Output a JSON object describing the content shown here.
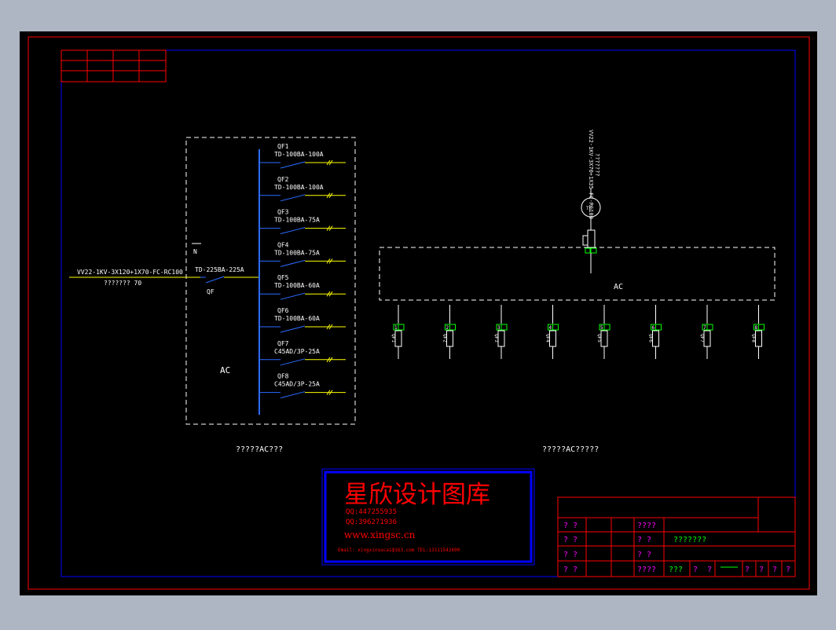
{
  "colors": {
    "viewport_bg": "#aeb6c3",
    "drawing_bg": "#000000",
    "outer_frame": "#ff0000",
    "inner_frame": "#0000ff",
    "line_white": "#ffffff",
    "bus_blue": "#0000ff",
    "breaker_blue": "#2b6cff",
    "feeder_yellow": "#ffff00",
    "green": "#00ff00",
    "magenta": "#ff00ff",
    "stamp_red": "#ff0000"
  },
  "left_diagram": {
    "incoming_cable": "VV22-1KV-3X120+1X70-FC-RC100",
    "incoming_sub": "???????  70",
    "neutral_label": "N",
    "main_breaker_spec": "TD-225BA-225A",
    "main_breaker_label": "QF",
    "panel_label": "AC",
    "caption": "?????AC???",
    "breakers": [
      {
        "name": "QF1",
        "spec": "TD-100BA-100A"
      },
      {
        "name": "QF2",
        "spec": "TD-100BA-100A"
      },
      {
        "name": "QF3",
        "spec": "TD-100BA-75A"
      },
      {
        "name": "QF4",
        "spec": "TD-100BA-75A"
      },
      {
        "name": "QF5",
        "spec": "TD-100BA-60A"
      },
      {
        "name": "QF6",
        "spec": "TD-100BA-60A"
      },
      {
        "name": "QF7",
        "spec": "C45AD/3P-25A"
      },
      {
        "name": "QF8",
        "spec": "C45AD/3P-25A"
      }
    ]
  },
  "right_diagram": {
    "cable_label": "VV22-1KV-3X70+1X35-FC-RC100",
    "cable_sub": "???????",
    "meter_label": "TB",
    "panel_label": "AC",
    "caption": "?????AC?????",
    "feeders": [
      {
        "id": "1",
        "name": "QF1"
      },
      {
        "id": "2",
        "name": "QF2"
      },
      {
        "id": "3",
        "name": "QF3"
      },
      {
        "id": "4",
        "name": "QF4"
      },
      {
        "id": "5",
        "name": "QF5"
      },
      {
        "id": "6",
        "name": "QF6"
      },
      {
        "id": "7",
        "name": "QF7"
      },
      {
        "id": "8",
        "name": "QF8"
      }
    ]
  },
  "stamp": {
    "title": "星欣设计图库",
    "qq1": "QQ:447255935",
    "qq2": "QQ:396271936",
    "website": "www.xingsc.cn",
    "email_line": "Email: xingxinsucai@163.com  TEL:13111542600"
  },
  "title_block": {
    "r1c1": "? ?",
    "r1c3": "????",
    "r2c1": "? ?",
    "r2c3": "?  ?",
    "r2c4": "???????",
    "r3c1": "? ?",
    "r3c3": "?  ?",
    "r4c1": "? ?",
    "r4c3": "????",
    "r4c4": "???",
    "r4c5": "?",
    "r4c6": "?",
    "r4c8": "?",
    "r4c9": "?",
    "r4c10": "?",
    "r4c11": "?"
  }
}
